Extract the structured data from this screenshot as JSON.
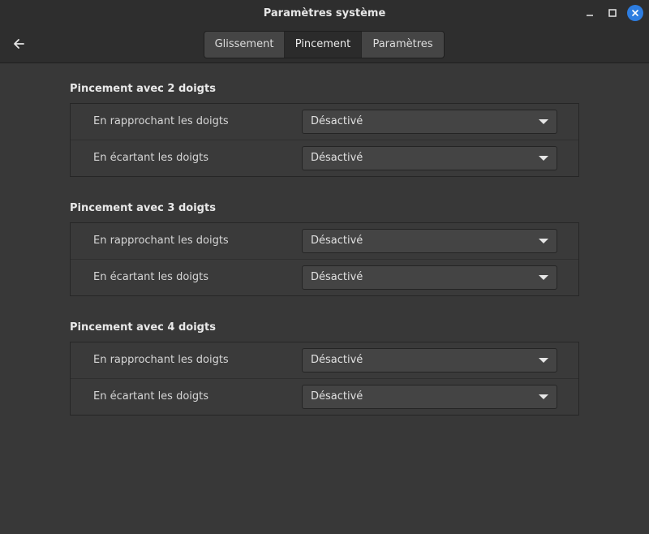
{
  "window": {
    "title": "Paramètres système"
  },
  "header": {
    "back_icon": "arrow-left-icon",
    "tabs": [
      {
        "label": "Glissement",
        "active": false
      },
      {
        "label": "Pincement",
        "active": true
      },
      {
        "label": "Paramètres",
        "active": false
      }
    ]
  },
  "window_controls": {
    "minimize_icon": "minimize-icon",
    "maximize_icon": "maximize-icon",
    "close_icon": "close-icon",
    "close_color": "#2d7de0"
  },
  "sections": [
    {
      "title": "Pincement avec 2 doigts",
      "rows": [
        {
          "label": "En rapprochant les doigts",
          "value": "Désactivé"
        },
        {
          "label": "En écartant les doigts",
          "value": "Désactivé"
        }
      ]
    },
    {
      "title": "Pincement avec 3 doigts",
      "rows": [
        {
          "label": "En rapprochant les doigts",
          "value": "Désactivé"
        },
        {
          "label": "En écartant les doigts",
          "value": "Désactivé"
        }
      ]
    },
    {
      "title": "Pincement avec 4 doigts",
      "rows": [
        {
          "label": "En rapprochant les doigts",
          "value": "Désactivé"
        },
        {
          "label": "En écartant les doigts",
          "value": "Désactivé"
        }
      ]
    }
  ]
}
